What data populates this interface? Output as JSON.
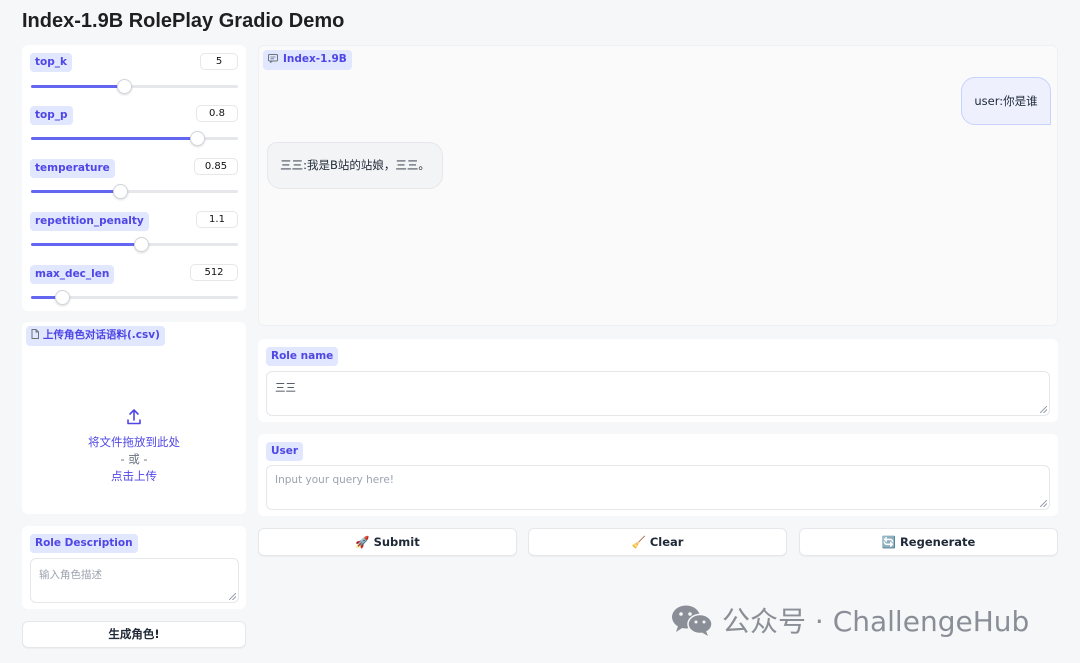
{
  "header": {
    "title": "Index-1.9B RolePlay Gradio Demo"
  },
  "params": [
    {
      "label": "top_k",
      "value": "5",
      "fraction": 0.45
    },
    {
      "label": "top_p",
      "value": "0.8",
      "fraction": 0.8
    },
    {
      "label": "temperature",
      "value": "0.85",
      "fraction": 0.43
    },
    {
      "label": "repetition_penalty",
      "value": "1.1",
      "fraction": 0.53
    },
    {
      "label": "max_dec_len",
      "value": "512",
      "fraction": 0.15
    }
  ],
  "upload": {
    "label": "上传角色对话语料(.csv)",
    "drop_text": "将文件拖放到此处",
    "or_text": "- 或 -",
    "click_text": "点击上传",
    "icon": "upload-icon"
  },
  "role_description": {
    "label": "Role Description",
    "placeholder": "输入角色描述"
  },
  "generate_button": "生成角色!",
  "chatbot": {
    "label": "Index-1.9B",
    "icon": "chat-icon",
    "messages": [
      {
        "role": "user",
        "text": "user:你是谁"
      },
      {
        "role": "bot",
        "text": "三三:我是B站的站娘，三三。"
      }
    ]
  },
  "role_name": {
    "label": "Role name",
    "value": "三三"
  },
  "user_input": {
    "label": "User",
    "placeholder": "Input your query here!"
  },
  "buttons": {
    "submit": "🚀 Submit",
    "clear": "🧹 Clear",
    "regenerate": "🔄 Regenerate"
  },
  "watermark": {
    "text": "公众号 · ChallengeHub",
    "icon": "wechat-icon"
  },
  "colors": {
    "accent": "#6366f1",
    "label_bg": "#e0e7ff",
    "label_text": "#4f46e5",
    "page_bg": "#f6f7f9"
  }
}
